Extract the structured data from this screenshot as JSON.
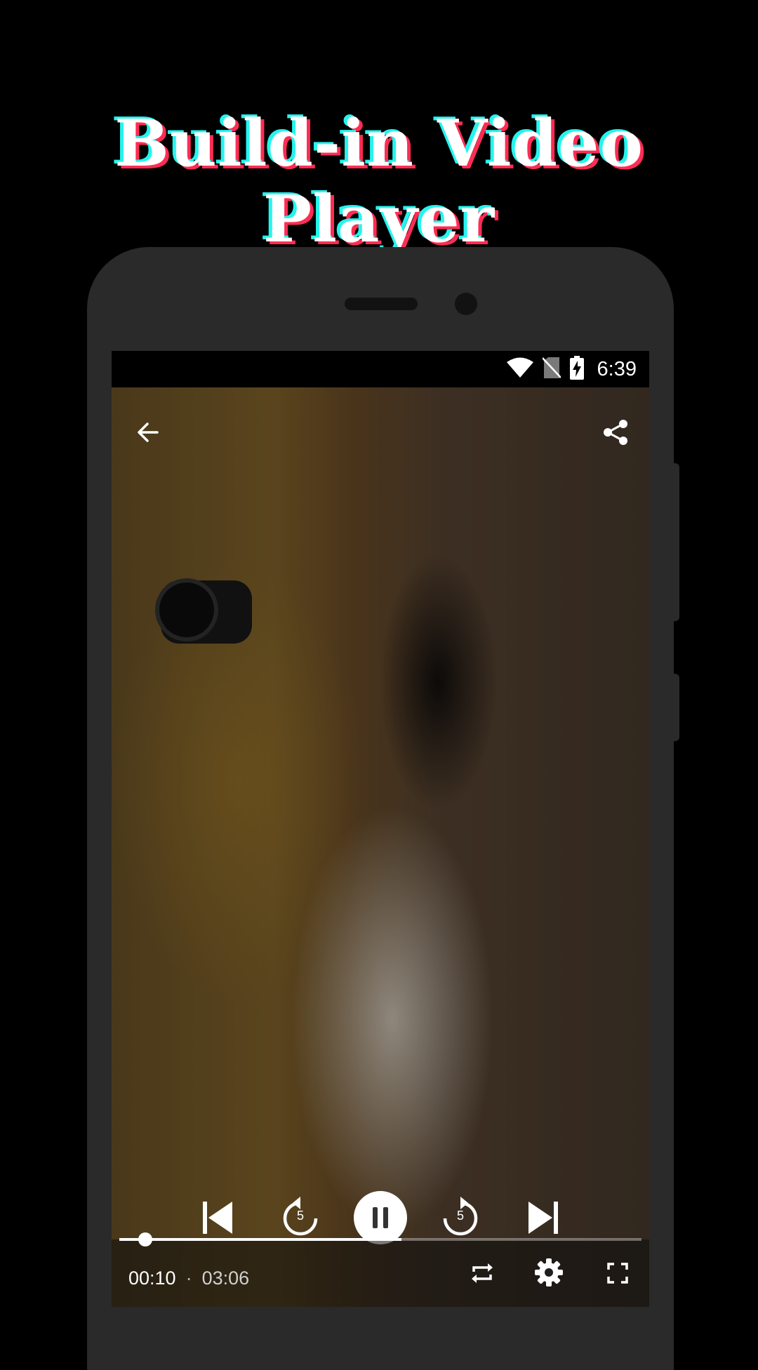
{
  "headline": "Build-in Video Player",
  "status_bar": {
    "time": "6:39",
    "icons": [
      "wifi-icon",
      "no-sim-icon",
      "battery-charging-icon"
    ]
  },
  "player": {
    "top_icons": [
      "back-arrow-icon",
      "share-icon"
    ],
    "controls": [
      "skip-previous-icon",
      "replay-5-icon",
      "pause-icon",
      "forward-5-icon",
      "skip-next-icon"
    ],
    "rewind_seconds": "5",
    "forward_seconds": "5",
    "current_time": "00:10",
    "separator": "·",
    "duration": "03:06",
    "progress_thumb_fraction": 0.05,
    "progress_buffered_fraction": 0.54,
    "bottom_icons": [
      "repeat-icon",
      "settings-gear-icon",
      "fullscreen-icon"
    ]
  },
  "colors": {
    "background": "#000000",
    "phone_body": "#2a2a2a",
    "headline_cyan_shadow": "#25f4ee",
    "headline_red_shadow": "#fe2c55",
    "icon_white": "#ffffff"
  }
}
